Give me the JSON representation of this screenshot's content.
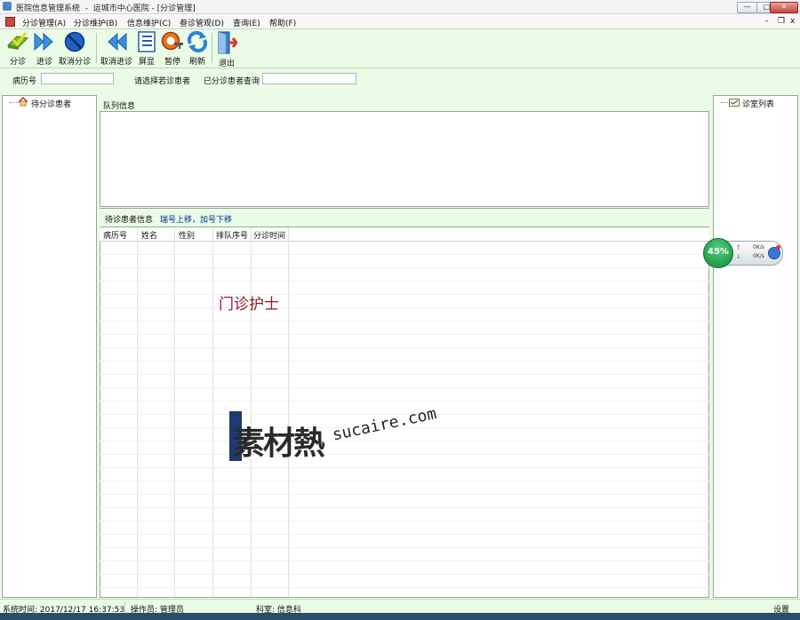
{
  "window": {
    "title": "医院信息管理系统  -  运城市中心医院 - [分诊管理]",
    "min": "—",
    "max": "□",
    "close": "✕",
    "mdi_min": "-",
    "mdi_restore": "❐",
    "mdi_close": "x"
  },
  "menu": {
    "items": [
      "分诊管理(A)",
      "分诊维护(B)",
      "信息维护(C)",
      "叁诊管观(D)",
      "查询(E)",
      "帮助(F)"
    ]
  },
  "toolbar": {
    "fenzhen": "分诊",
    "jinzhen": "进诊",
    "cancel_fenzhen": "取消分诊",
    "cancel_jinzhen": "取消进诊",
    "pingxian": "屏显",
    "zanting": "暂停",
    "shuaxin": "刷新",
    "tuichu": "退出"
  },
  "search": {
    "record_label": "病历号",
    "record_value": "",
    "select_label": "请选择若诊患者",
    "query_label": "已分诊患者查询",
    "query_value": ""
  },
  "left_tree": {
    "root": "待分诊患者"
  },
  "queue": {
    "title": "队列信息"
  },
  "waiting": {
    "title": "待诊患者信息",
    "hint": "瑞号上移，加号下移",
    "columns": [
      "病历号",
      "姓名",
      "性别",
      "排队序号",
      "分诊时间"
    ]
  },
  "overlay_text": "门诊护士",
  "right_tree": {
    "root": "诊室列表"
  },
  "widget": {
    "percent": "45%",
    "up": "0K/s",
    "down": "0K/s",
    "up_arrow": "↑",
    "down_arrow": "↓"
  },
  "watermark": {
    "cn": "素材熱",
    "url": "sucaire.com"
  },
  "status": {
    "time": "系统时间: 2017/12/17 16:37:53",
    "operator": "操作员: 管理员",
    "dept": "科室: 信息科",
    "settings": "设置"
  },
  "colors": {
    "accent": "#00308f",
    "overlay": "#8b1a2b",
    "panel_bg": "#eafbe6"
  }
}
